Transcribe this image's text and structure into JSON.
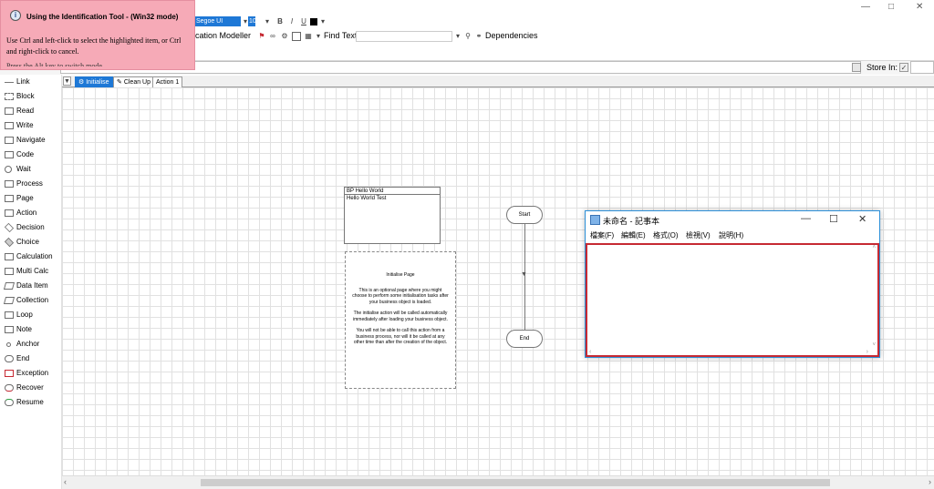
{
  "tooltip": {
    "title": "Using the Identification Tool - (Win32 mode)",
    "body": "Use Ctrl and left-click to select the highlighted item, or Ctrl and right-click to cancel.",
    "cut_line": "Press the Alt key to switch mode"
  },
  "toolbar": {
    "font_name": "Segoe UI",
    "font_size": "10",
    "bold": "B",
    "italic": "I",
    "underline": "U",
    "app_name_fragment": "cation Modeller",
    "find_text": "Find Text",
    "dependencies": "Dependencies"
  },
  "store": {
    "label": "Store In:"
  },
  "palette": {
    "items": [
      {
        "label": "Link"
      },
      {
        "label": "Block"
      },
      {
        "label": "Read"
      },
      {
        "label": "Write"
      },
      {
        "label": "Navigate"
      },
      {
        "label": "Code"
      },
      {
        "label": "Wait"
      },
      {
        "label": "Process"
      },
      {
        "label": "Page"
      },
      {
        "label": "Action"
      },
      {
        "label": "Decision"
      },
      {
        "label": "Choice"
      },
      {
        "label": "Calculation"
      },
      {
        "label": "Multi Calc"
      },
      {
        "label": "Data Item"
      },
      {
        "label": "Collection"
      },
      {
        "label": "Loop"
      },
      {
        "label": "Note"
      },
      {
        "label": "Anchor"
      },
      {
        "label": "End"
      },
      {
        "label": "Exception"
      },
      {
        "label": "Recover"
      },
      {
        "label": "Resume"
      }
    ]
  },
  "tabs": [
    {
      "label": "Initialise"
    },
    {
      "label": "Clean Up"
    },
    {
      "label": "Action 1"
    }
  ],
  "canvas": {
    "info_box_title": "BP Hello World",
    "info_box_subtitle": "Hello World Test",
    "note_title": "Initialise Page",
    "note_p1": "This is an optional page where you might choose to perform some initialisation tasks after your business object is loaded.",
    "note_p2": "The initialise action will be called automatically immediately after loading your business object.",
    "note_p3": "You will not be able to call this action from a business process, nor will it be called at any other time than after the creation of the object.",
    "start_label": "Start",
    "end_label": "End"
  },
  "notepad": {
    "title": "未命名 - 記事本",
    "menu": [
      "檔案(F)",
      "編輯(E)",
      "格式(O)",
      "檢視(V)",
      "說明(H)"
    ]
  }
}
